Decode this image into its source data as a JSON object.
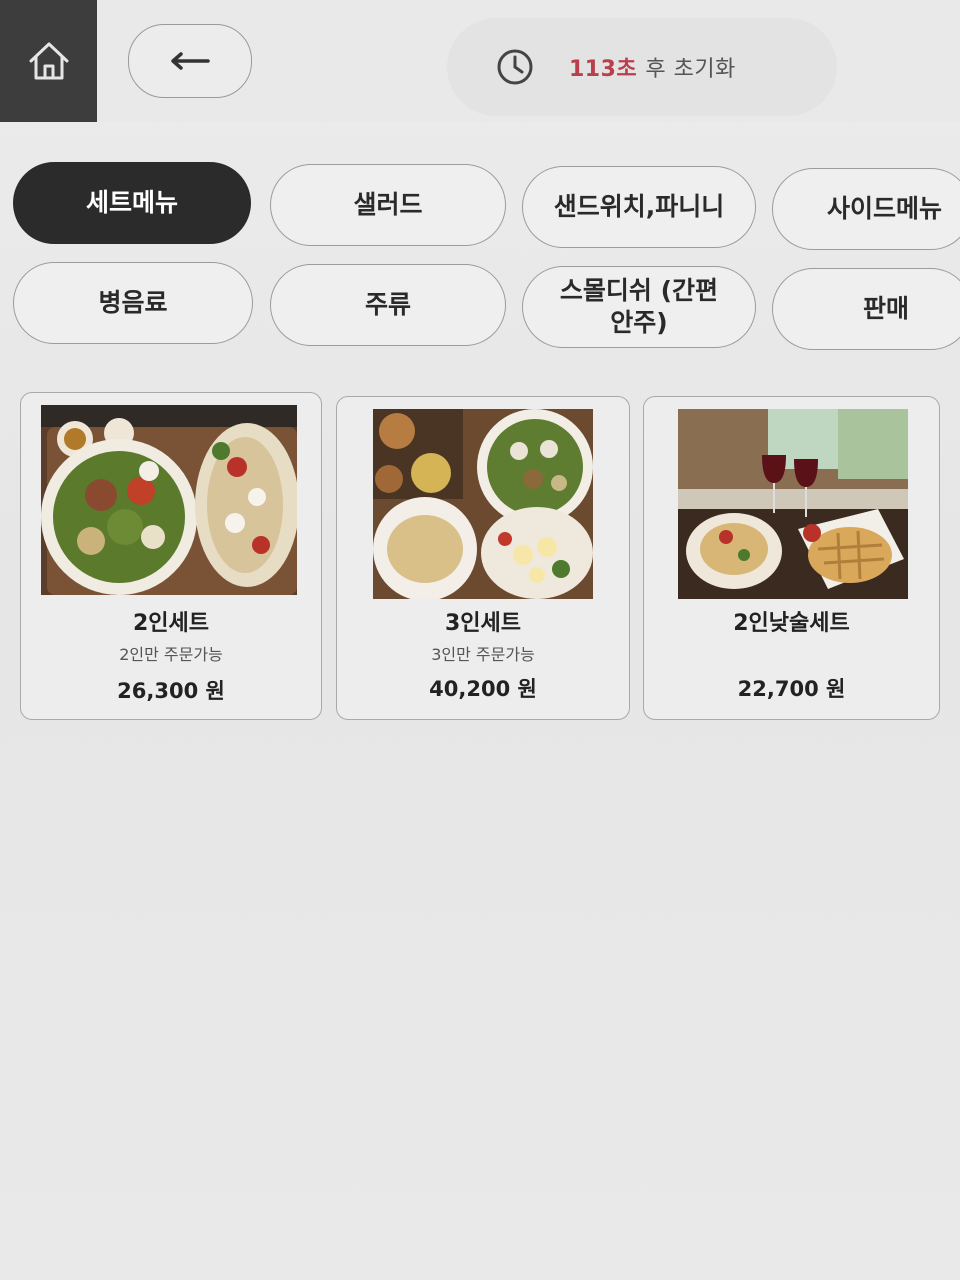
{
  "header": {
    "timer_seconds": "113초",
    "timer_suffix": "후 초기화"
  },
  "icons": {
    "home": "home-icon",
    "back": "arrow-left-icon",
    "clock": "clock-icon"
  },
  "categories": [
    {
      "label": "세트메뉴",
      "active": true
    },
    {
      "label": "샐러드"
    },
    {
      "label": "샌드위치,파니니"
    },
    {
      "label": "사이드메뉴"
    },
    {
      "label": "병음료"
    },
    {
      "label": "주류"
    },
    {
      "label": "스몰디쉬 (간편안주)"
    },
    {
      "label": "판매"
    }
  ],
  "products": [
    {
      "name": "2인세트",
      "note": "2인만 주문가능",
      "price": "26,300 원"
    },
    {
      "name": "3인세트",
      "note": "3인만 주문가능",
      "price": "40,200 원"
    },
    {
      "name": "2인낮술세트",
      "note": "",
      "price": "22,700 원"
    }
  ],
  "colors": {
    "accent": "#b8404a",
    "active_tab": "#2b2b2b",
    "home_bg": "#3d3d3d"
  }
}
